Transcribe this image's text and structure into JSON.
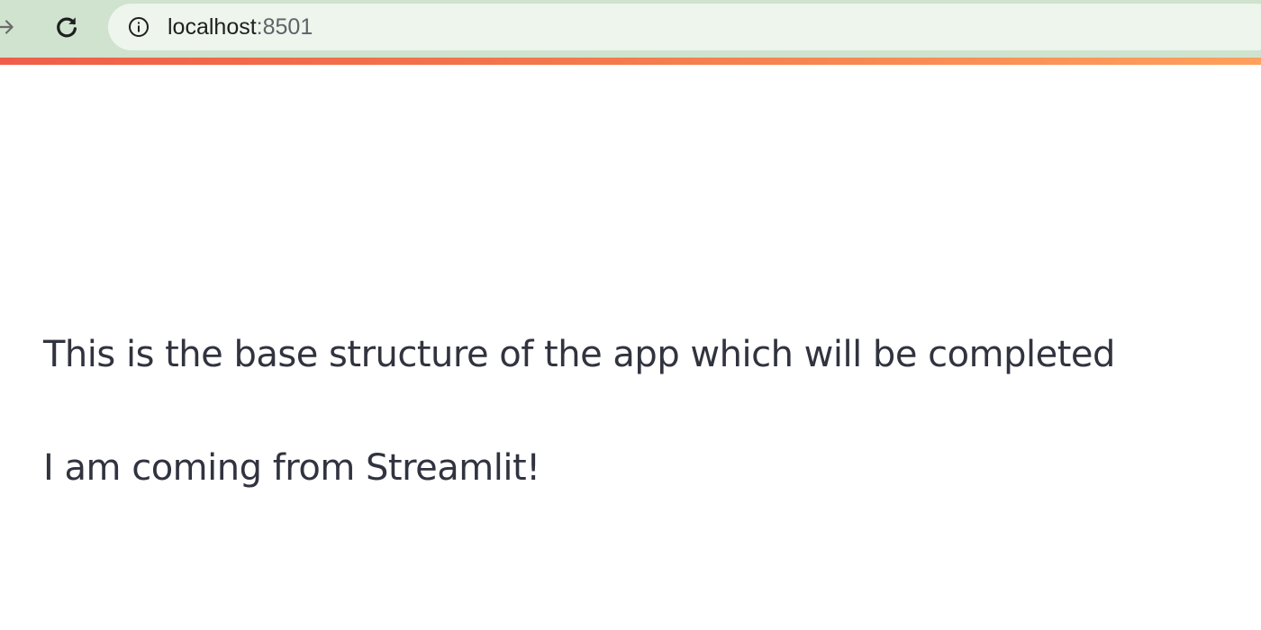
{
  "browser": {
    "url_host": "localhost",
    "url_port": ":8501",
    "forward_icon": "arrow-right-icon",
    "reload_icon": "reload-icon",
    "info_icon": "info-icon"
  },
  "app": {
    "text_line_1": "This is the base structure of the app which will be completed",
    "text_line_2": "I am coming from Streamlit!",
    "decoration_colors": [
      "#ef5e49",
      "#ffa05c"
    ],
    "text_color": "#31333f"
  }
}
